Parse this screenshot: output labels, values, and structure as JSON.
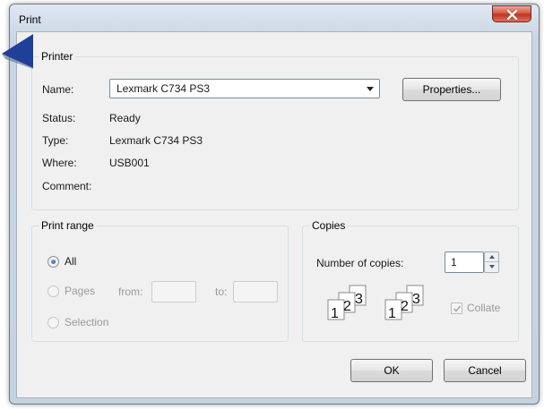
{
  "window": {
    "title": "Print"
  },
  "printer": {
    "group_label": "Printer",
    "name_label": "Name:",
    "name_value": "Lexmark C734 PS3",
    "properties_button": "Properties...",
    "status_label": "Status:",
    "status_value": "Ready",
    "type_label": "Type:",
    "type_value": "Lexmark C734 PS3",
    "where_label": "Where:",
    "where_value": "USB001",
    "comment_label": "Comment:"
  },
  "print_range": {
    "group_label": "Print range",
    "all_label": "All",
    "pages_label": "Pages",
    "from_label": "from:",
    "to_label": "to:",
    "selection_label": "Selection",
    "selected": "All"
  },
  "copies": {
    "group_label": "Copies",
    "number_label": "Number of copies:",
    "number_value": "1",
    "collate_label": "Collate",
    "collate_checked": true,
    "collate_pages": [
      "1",
      "2",
      "3"
    ]
  },
  "buttons": {
    "ok": "OK",
    "cancel": "Cancel"
  },
  "colors": {
    "pointer": "#1f3f99",
    "close_button": "#c9432d"
  },
  "icons": {
    "close": "close-icon",
    "pointer": "pointer-arrow-icon"
  }
}
